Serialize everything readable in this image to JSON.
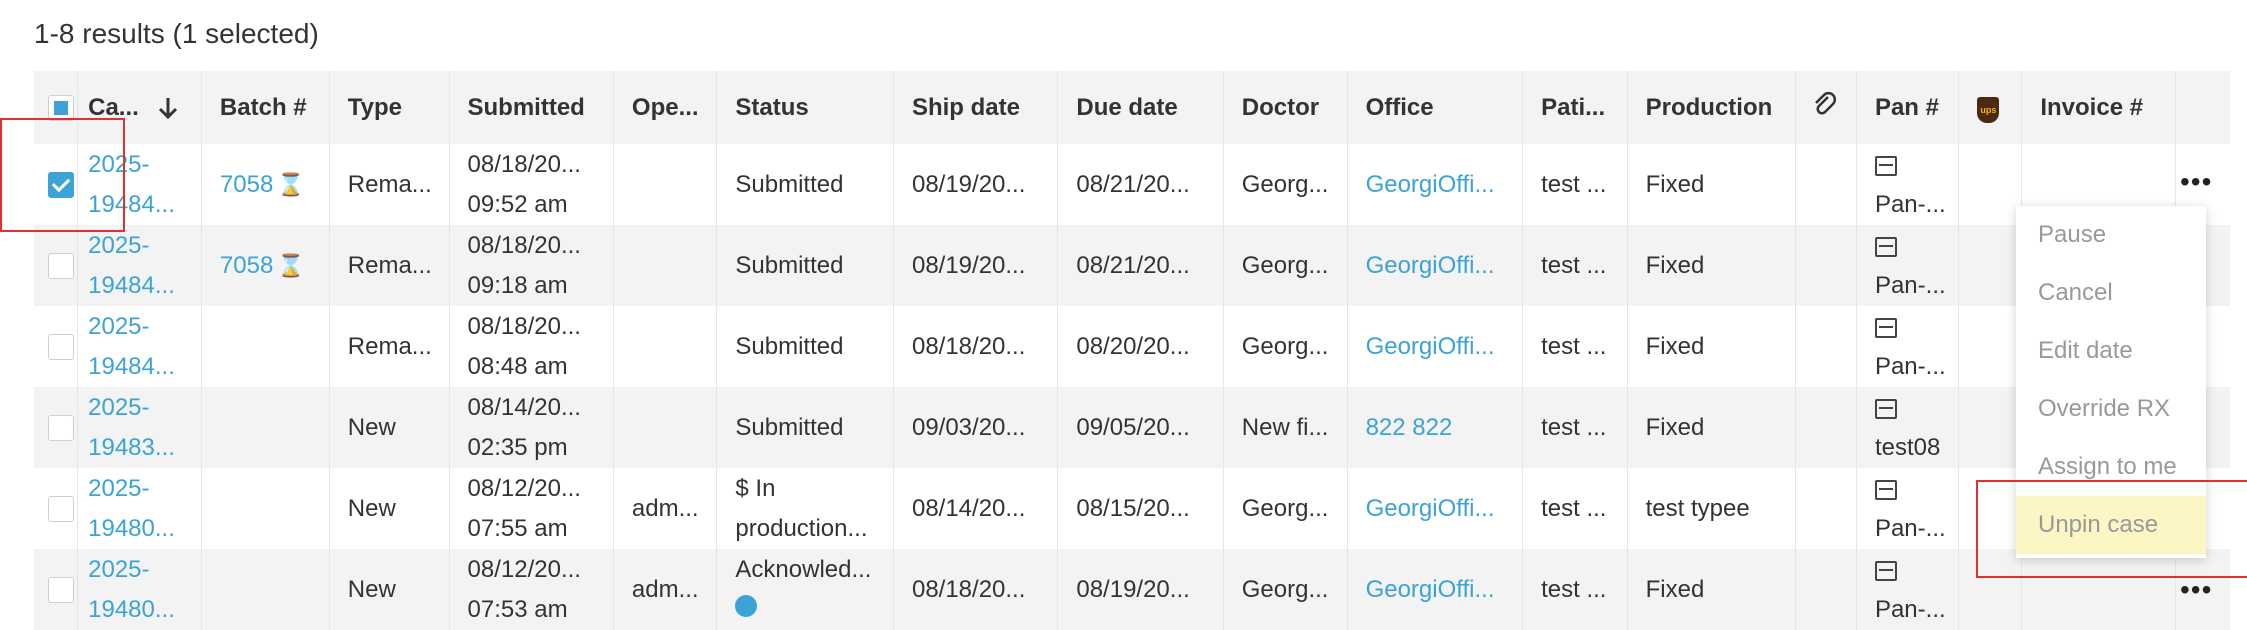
{
  "results_text": "1-8 results (1 selected)",
  "columns": [
    "Ca...",
    "Batch #",
    "Type",
    "Submitted",
    "Ope...",
    "Status",
    "Ship date",
    "Due date",
    "Doctor",
    "Office",
    "Pati...",
    "Production",
    "Pan #",
    "Invoice #"
  ],
  "icons": {
    "sort": "arrow-down-icon",
    "attachment": "paperclip-icon",
    "ups": "ups-logo-icon",
    "more": "more-horizontal-icon",
    "hourglass": "hourglass-icon",
    "pan": "tray-icon"
  },
  "rows": [
    {
      "selected": true,
      "case1": "2025-",
      "case2": "19484...",
      "batch": "7058",
      "type": "Rema...",
      "sub1": "08/18/20...",
      "sub2": "09:52 am",
      "operator": "",
      "status1": "Submitted",
      "status2": "",
      "ship": "08/19/20...",
      "due": "08/21/20...",
      "doctor": "Georg...",
      "office": "GeorgiOffi...",
      "patient": "test ...",
      "production": "Fixed",
      "pan": "Pan-..."
    },
    {
      "selected": false,
      "case1": "2025-",
      "case2": "19484...",
      "batch": "7058",
      "type": "Rema...",
      "sub1": "08/18/20...",
      "sub2": "09:18 am",
      "operator": "",
      "status1": "Submitted",
      "status2": "",
      "ship": "08/19/20...",
      "due": "08/21/20...",
      "doctor": "Georg...",
      "office": "GeorgiOffi...",
      "patient": "test ...",
      "production": "Fixed",
      "pan": "Pan-..."
    },
    {
      "selected": false,
      "case1": "2025-",
      "case2": "19484...",
      "batch": "",
      "type": "Rema...",
      "sub1": "08/18/20...",
      "sub2": "08:48 am",
      "operator": "",
      "status1": "Submitted",
      "status2": "",
      "ship": "08/18/20...",
      "due": "08/20/20...",
      "doctor": "Georg...",
      "office": "GeorgiOffi...",
      "patient": "test ...",
      "production": "Fixed",
      "pan": "Pan-..."
    },
    {
      "selected": false,
      "case1": "2025-",
      "case2": "19483...",
      "batch": "",
      "type": "New",
      "sub1": "08/14/20...",
      "sub2": "02:35 pm",
      "operator": "",
      "status1": "Submitted",
      "status2": "",
      "ship": "09/03/20...",
      "due": "09/05/20...",
      "doctor": "New fi...",
      "office": "822 822",
      "patient": "test ...",
      "production": "Fixed",
      "pan": "test08"
    },
    {
      "selected": false,
      "case1": "2025-",
      "case2": "19480...",
      "batch": "",
      "type": "New",
      "sub1": "08/12/20...",
      "sub2": "07:55 am",
      "operator": "adm...",
      "status1": "$ In",
      "status2": "production...",
      "ship": "08/14/20...",
      "due": "08/15/20...",
      "doctor": "Georg...",
      "office": "GeorgiOffi...",
      "patient": "test ...",
      "production": "test typee",
      "pan": "Pan-..."
    },
    {
      "selected": false,
      "case1": "2025-",
      "case2": "19480...",
      "batch": "",
      "type": "New",
      "sub1": "08/12/20...",
      "sub2": "07:53 am",
      "operator": "adm...",
      "status1": "Acknowled...",
      "status2": "",
      "ship": "08/18/20...",
      "due": "08/19/20...",
      "doctor": "Georg...",
      "office": "GeorgiOffi...",
      "patient": "test ...",
      "production": "Fixed",
      "pan": "Pan-..."
    }
  ],
  "context_menu": [
    "Pause",
    "Cancel",
    "Edit date",
    "Override RX",
    "Assign to me",
    "Unpin case"
  ],
  "colors": {
    "link": "#3ba3d6",
    "header_bg": "#f3f3f3",
    "highlight": "#fbf6c4",
    "annotation": "#e03030"
  }
}
